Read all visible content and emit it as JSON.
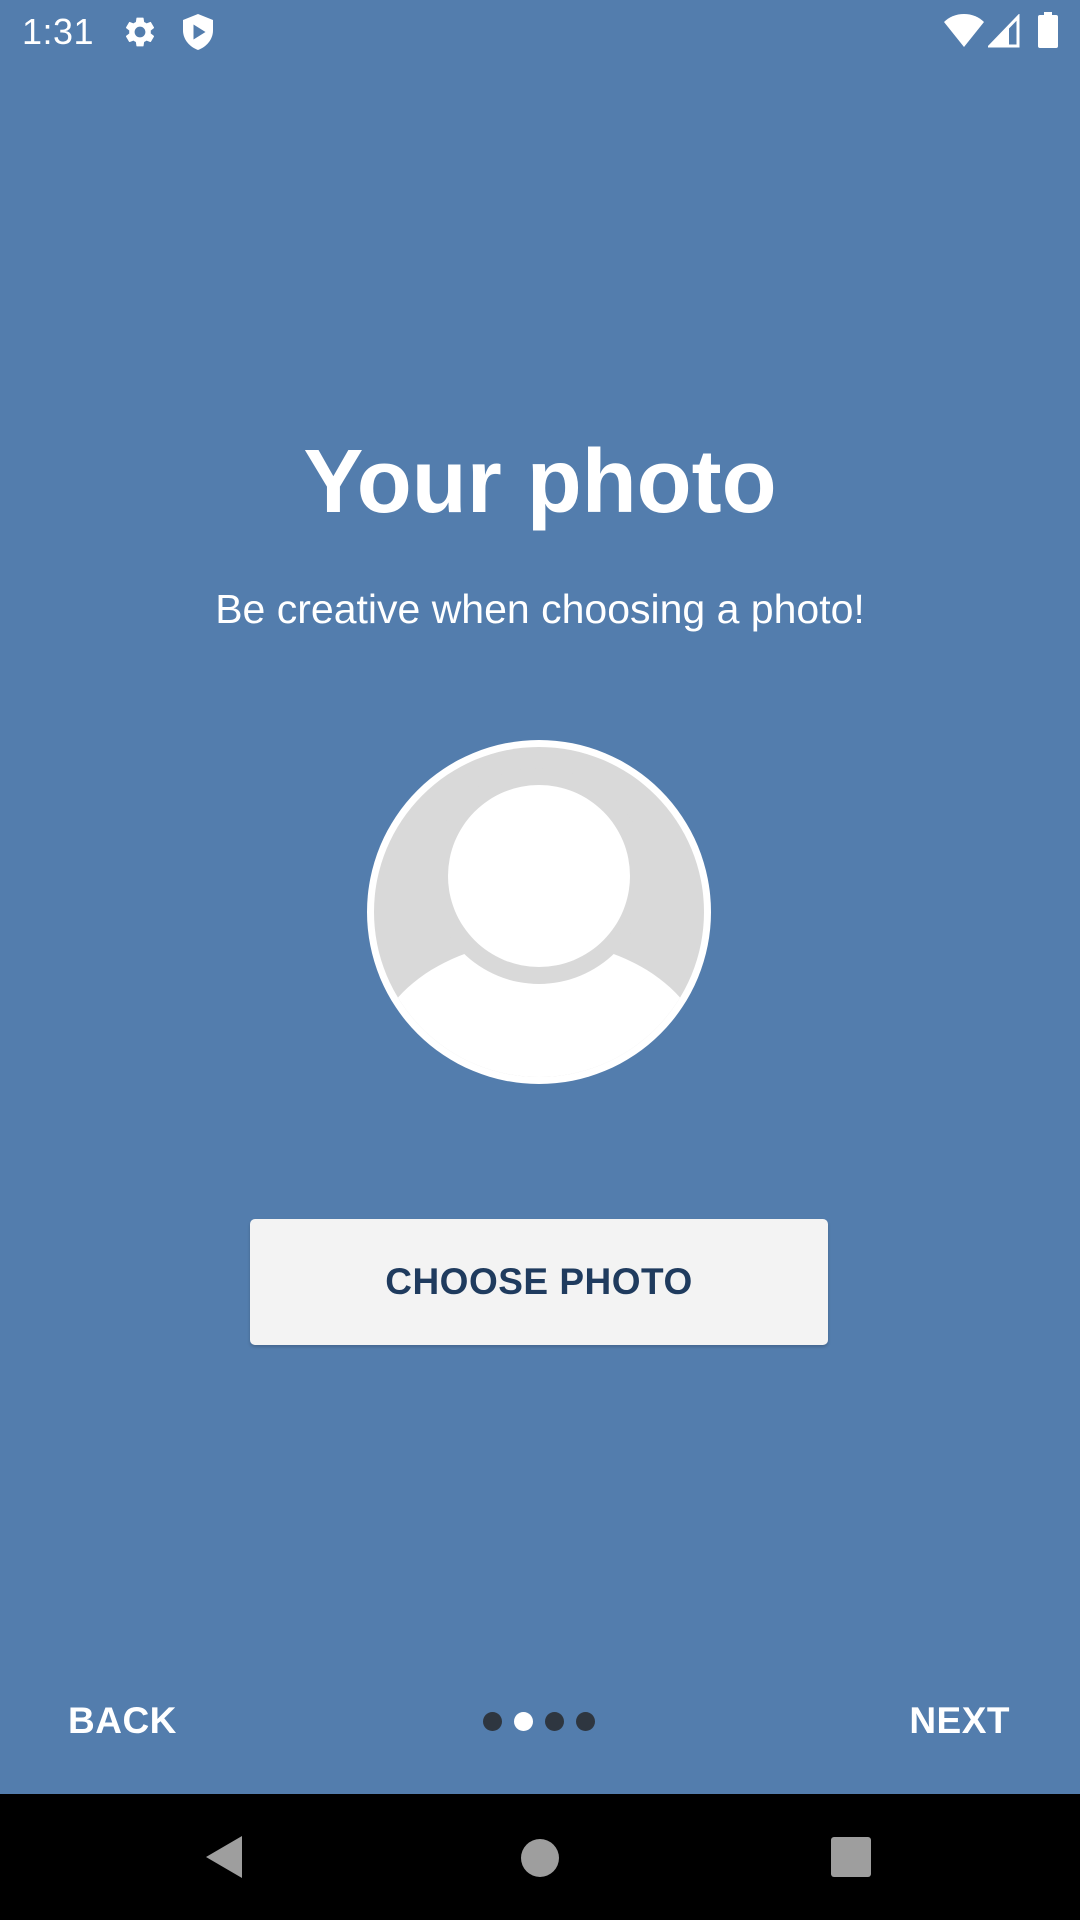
{
  "status_bar": {
    "time": "1:31",
    "icons": [
      "settings-gear-icon",
      "shield-play-icon",
      "wifi-icon",
      "cell-signal-icon",
      "battery-icon"
    ]
  },
  "content": {
    "title": "Your photo",
    "subtitle": "Be creative when choosing a photo!",
    "avatar_icon": "default-avatar-placeholder",
    "choose_button_label": "CHOOSE PHOTO"
  },
  "intro_nav": {
    "back_label": "BACK",
    "next_label": "NEXT",
    "page_count": 4,
    "current_page": 2
  },
  "system_nav": {
    "buttons": [
      "back-triangle-icon",
      "home-circle-icon",
      "recents-square-icon"
    ]
  },
  "colors": {
    "background": "#537dad",
    "button_background": "#f3f3f3",
    "button_text": "#1f3b5e",
    "dot_inactive": "#2e3640",
    "dot_active": "#ffffff",
    "avatar_background": "#d9d9d9"
  }
}
